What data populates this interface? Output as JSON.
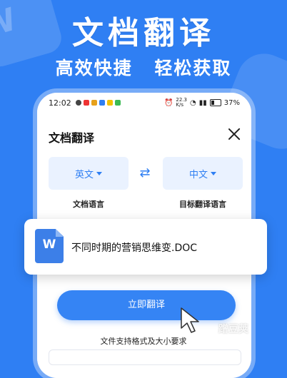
{
  "hero": {
    "title": "文档翻译",
    "subtitle_left": "高效快捷",
    "subtitle_right": "轻松获取"
  },
  "status_bar": {
    "time": "12:02",
    "net_speed": "22.3\nK/s",
    "battery": "37%"
  },
  "dialog": {
    "title": "文档翻译",
    "source_lang": "英文",
    "target_lang": "中文",
    "source_caption": "文档语言",
    "target_caption": "目标翻译语言"
  },
  "file": {
    "icon_letter": "W",
    "name": "不同时期的营销思维变.DOC"
  },
  "actions": {
    "translate": "立即翻译"
  },
  "footer": {
    "support_text": "文件支持格式及大小要求",
    "watermark": "蹭豆荚"
  },
  "colors": {
    "brand_blue": "#2f7ff3",
    "button_blue": "#3584f4",
    "lang_box_bg": "#eaf2ff"
  }
}
